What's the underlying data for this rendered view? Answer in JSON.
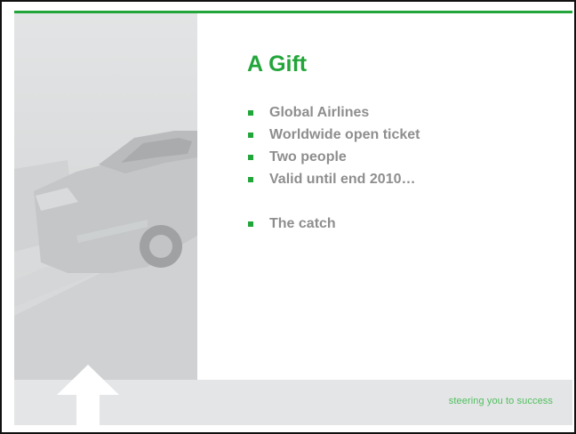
{
  "slide": {
    "title": "A Gift",
    "bullets": [
      {
        "text": "Global Airlines"
      },
      {
        "text": "Worldwide open ticket"
      },
      {
        "text": "Two people"
      },
      {
        "text": "Valid until end 2010…"
      },
      {
        "text": "The catch"
      }
    ],
    "tagline": "steering you to success"
  },
  "colors": {
    "accent": "#22a53a",
    "bullet_text": "#8e8e8e",
    "tagline": "#4fbf5f",
    "footer_band": "#e4e5e6"
  },
  "icons": {
    "footer_arrow": "up-arrow-icon"
  }
}
